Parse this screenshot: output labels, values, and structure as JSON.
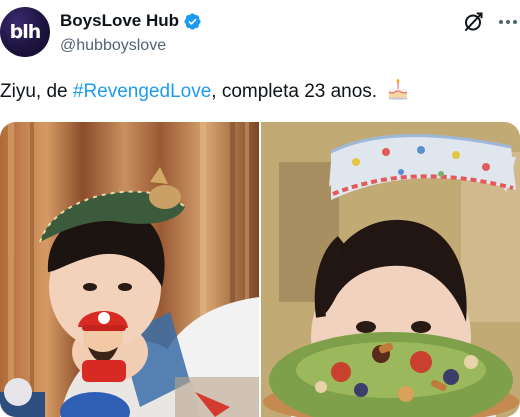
{
  "account": {
    "display_name": "BoysLove Hub",
    "handle": "@hubboyslove",
    "avatar_text": "blh",
    "verified": true
  },
  "header_actions": {
    "grok_icon": "grok-slash-icon",
    "more_icon": "more-dots-icon"
  },
  "post": {
    "text_before": "Ziyu, de ",
    "hashtag": "#RevengedLove",
    "text_after": ", completa 23 anos.",
    "emoji": "birthday-cake-icon"
  },
  "media": {
    "photos": [
      {
        "label": "photo-left"
      },
      {
        "label": "photo-right"
      }
    ]
  },
  "colors": {
    "accent": "#1d9bf0",
    "text": "#0f1419",
    "muted": "#536471"
  }
}
